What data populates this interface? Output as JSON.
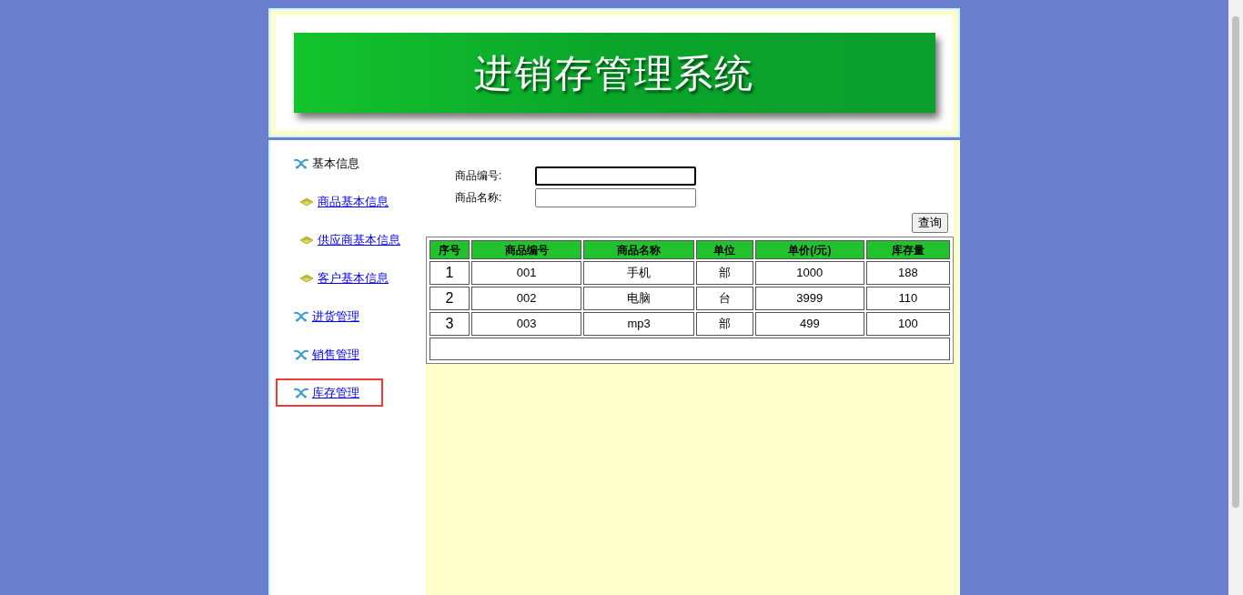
{
  "banner": {
    "title": "进销存管理系统"
  },
  "sidebar": {
    "items": [
      {
        "kind": "header",
        "label": "基本信息",
        "selected": false
      },
      {
        "kind": "sub",
        "label": "商品基本信息",
        "selected": false
      },
      {
        "kind": "sub",
        "label": "供应商基本信息",
        "selected": false
      },
      {
        "kind": "sub",
        "label": "客户基本信息",
        "selected": false
      },
      {
        "kind": "link",
        "label": "进货管理",
        "selected": false
      },
      {
        "kind": "link",
        "label": "销售管理",
        "selected": false
      },
      {
        "kind": "link",
        "label": "库存管理",
        "selected": true
      }
    ]
  },
  "search_form": {
    "fields": [
      {
        "label": "商品编号:",
        "focused": true
      },
      {
        "label": "商品名称:",
        "focused": false
      }
    ],
    "button": "查询"
  },
  "table": {
    "columns": [
      "序号",
      "商品编号",
      "商品名称",
      "单位",
      "单价(/元)",
      "库存量"
    ],
    "rows": [
      [
        "1",
        "001",
        "手机",
        "部",
        "1000",
        "188"
      ],
      [
        "2",
        "002",
        "电脑",
        "台",
        "3999",
        "110"
      ],
      [
        "3",
        "003",
        "mp3",
        "部",
        "499",
        "100"
      ]
    ]
  }
}
